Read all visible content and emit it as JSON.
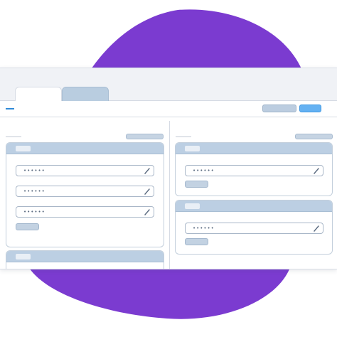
{
  "colors": {
    "blob": "#7b3bd0",
    "accent_button": "#64b1f2",
    "panel_header": "#bccfe3"
  },
  "tabs": [
    {
      "label": "",
      "state": "active"
    },
    {
      "label": "",
      "state": "inactive"
    }
  ],
  "toolbar": {
    "breadcrumb": "",
    "secondary_button": "",
    "primary_button": ""
  },
  "left_column": {
    "label": "",
    "action_button": "",
    "panels": [
      {
        "title": "",
        "fields": [
          {
            "value": "••••••"
          },
          {
            "value": "••••••"
          },
          {
            "value": "••••••"
          }
        ],
        "button": ""
      },
      {
        "title": "",
        "fields": [],
        "button": ""
      }
    ]
  },
  "right_column": {
    "label": "",
    "action_button": "",
    "panels": [
      {
        "title": "",
        "fields": [
          {
            "value": "••••••"
          }
        ],
        "button": ""
      },
      {
        "title": "",
        "fields": [
          {
            "value": "••••••"
          }
        ],
        "button": ""
      }
    ]
  },
  "icons": {
    "field_edit": "pencil-icon"
  }
}
